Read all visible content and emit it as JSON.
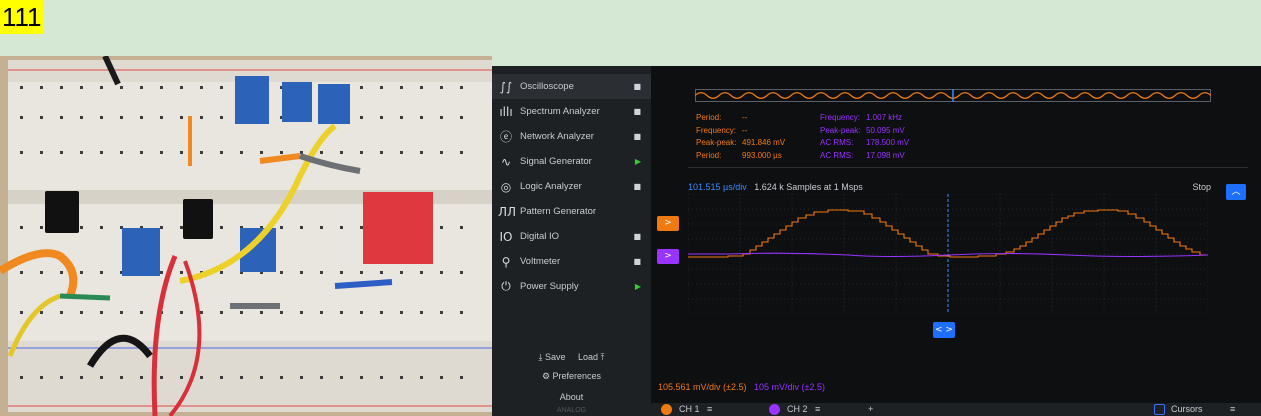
{
  "label_tag": "111",
  "sidebar": {
    "items": [
      {
        "icon": "∫∫",
        "label": "Oscilloscope",
        "status": "■"
      },
      {
        "icon": "ıllı",
        "label": "Spectrum Analyzer",
        "status": "■"
      },
      {
        "icon": "ⓔ",
        "label": "Network Analyzer",
        "status": "■"
      },
      {
        "icon": "∿",
        "label": "Signal Generator",
        "status": "▶"
      },
      {
        "icon": "◎",
        "label": "Logic Analyzer",
        "status": "■"
      },
      {
        "icon": "ЛЛ",
        "label": "Pattern Generator",
        "status": ""
      },
      {
        "icon": "IO",
        "label": "Digital IO",
        "status": "■"
      },
      {
        "icon": "⚲",
        "label": "Voltmeter",
        "status": "■"
      },
      {
        "icon": "⏻",
        "label": "Power Supply",
        "status": "▶"
      }
    ],
    "save_label": "Save",
    "load_label": "Load",
    "preferences_label": "Preferences",
    "about_label": "About",
    "footer_logo": "ANALOG"
  },
  "measurements": {
    "ch1": {
      "period_label": "Period:",
      "period_value": "--",
      "frequency_label": "Frequency:",
      "frequency_value": "--",
      "peakpeak_label": "Peak-peak:",
      "peakpeak_value": "491.846 mV",
      "period2_label": "Period:",
      "period2_value": "993.000 µs"
    },
    "ch2": {
      "frequency_label": "Frequency:",
      "frequency_value": "1.007 kHz",
      "peakpeak_label": "Peak-peak:",
      "peakpeak_value": "50.095 mV",
      "acrms_label": "AC RMS:",
      "acrms_value": "178.500 mV",
      "acrms2_label": "AC RMS:",
      "acrms2_value": "17.098 mV"
    }
  },
  "plot": {
    "timebase": "101.515 µs/div",
    "samples": "1.624 k Samples at 1 Msps",
    "state": "Stop",
    "ch1_marker": ">",
    "ch2_marker": ">",
    "cursor_button": "< >",
    "ch1_vdiv": "105.561 mV/div (±2.5)",
    "ch2_vdiv": "105 mV/div (±2.5)"
  },
  "bottombar": {
    "ch1_label": "CH 1",
    "ch2_label": "CH 2",
    "add_label": "+",
    "cursors_label": "Cursors",
    "settings_glyph": "≡"
  },
  "colors": {
    "ch1": "#f07a12",
    "ch2": "#9933ff",
    "accent": "#1f6fff",
    "background": "#0e0f11"
  }
}
